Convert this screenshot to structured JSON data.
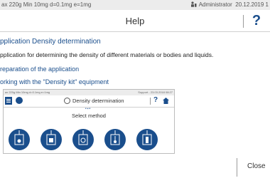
{
  "status_bar": {
    "device_info": "ax 220g  Min 10mg  d=0.1mg  e=1mg",
    "user": "Administrator",
    "date": "20.12.2019 1"
  },
  "header": {
    "title": "Help"
  },
  "help_content": {
    "heading": "pplication Density determination",
    "description": "pplication for determining the density of different materials or bodies and liquids.",
    "section_preparation": "reparation of the application",
    "section_working": "orking with the \"Density kit\" equipment"
  },
  "preview_screen": {
    "status_left": "ax 220g  Min 10mg  d=0.1mg  e=1mg",
    "status_right": "Support - 23.03.2018 08:27",
    "title": "Density determination",
    "select_method": "Select method",
    "methods": [
      "method-1-icon",
      "method-2-icon",
      "method-3-icon",
      "method-4-icon",
      "method-5-icon"
    ]
  },
  "footer": {
    "close_label": "Close"
  },
  "colors": {
    "accent": "#1a4e8c",
    "status_bg": "#ececec"
  }
}
